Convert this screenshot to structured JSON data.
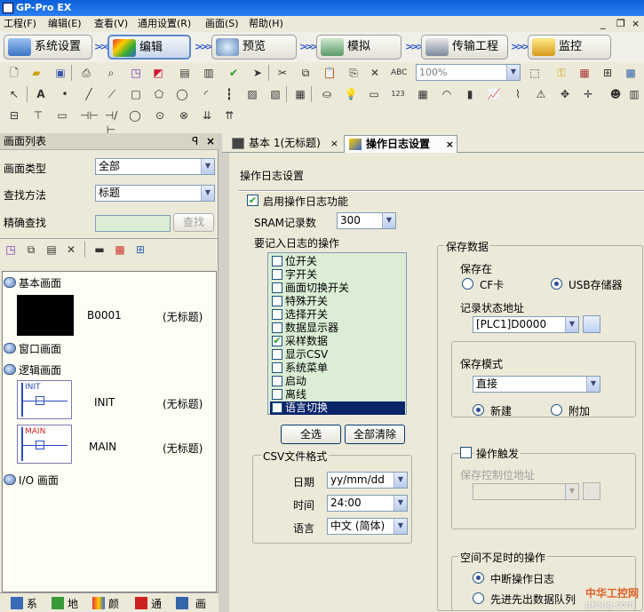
{
  "window": {
    "title": "GP-Pro EX"
  },
  "menu": [
    "工程(F)",
    "编辑(E)",
    "查看(V)",
    "通用设置(R)",
    "画面(S)",
    "帮助(H)"
  ],
  "wizard": [
    {
      "label": "系统设置",
      "icon": "system-settings-icon",
      "selected": false
    },
    {
      "label": "编辑",
      "icon": "paint-brush-icon",
      "selected": true
    },
    {
      "label": "预览",
      "icon": "preview-icon",
      "selected": false
    },
    {
      "label": "模拟",
      "icon": "simulation-icon",
      "selected": false
    },
    {
      "label": "传输工程",
      "icon": "transfer-icon",
      "selected": false
    },
    {
      "label": "监控",
      "icon": "monitor-icon",
      "selected": false
    }
  ],
  "toolbar": {
    "zoom_value": "100%"
  },
  "screen_list": {
    "title": "画面列表",
    "pin": "ꟼ",
    "close": "×",
    "type_label": "画面类型",
    "type_value": "全部",
    "method_label": "查找方法",
    "method_value": "标题",
    "search_label": "精确查找",
    "search_button": "查找",
    "tree": {
      "basic": "基本画面",
      "basic_items": [
        {
          "id": "B0001",
          "title": "(无标题)"
        }
      ],
      "window": "窗口画面",
      "logic": "逻辑画面",
      "logic_items": [
        {
          "thumb": "INIT",
          "id": "INIT",
          "title": "(无标题)"
        },
        {
          "thumb": "MAIN",
          "id": "MAIN",
          "title": "(无标题)"
        }
      ],
      "io": "I/O 画面"
    },
    "bottom_tabs": [
      "系",
      "地",
      "颜",
      "通",
      "画"
    ]
  },
  "editor_tabs": [
    {
      "label": "基本 1(无标题)",
      "active": false,
      "close": "×"
    },
    {
      "label": "操作日志设置",
      "active": true,
      "close": "×"
    }
  ],
  "oplog": {
    "section_title": "操作日志设置",
    "enable_label": "启用操作日志功能",
    "enable_checked": true,
    "sram_label": "SRAM记录数",
    "sram_value": "300",
    "ops_label": "要记入日志的操作",
    "ops": [
      {
        "label": "位开关",
        "checked": false,
        "selected": false
      },
      {
        "label": "字开关",
        "checked": false,
        "selected": false
      },
      {
        "label": "画面切换开关",
        "checked": false,
        "selected": false
      },
      {
        "label": "特殊开关",
        "checked": false,
        "selected": false
      },
      {
        "label": "选择开关",
        "checked": false,
        "selected": false
      },
      {
        "label": "数据显示器",
        "checked": false,
        "selected": false
      },
      {
        "label": "采样数据",
        "checked": true,
        "selected": false
      },
      {
        "label": "显示CSV",
        "checked": false,
        "selected": false
      },
      {
        "label": "系统菜单",
        "checked": false,
        "selected": false
      },
      {
        "label": "启动",
        "checked": false,
        "selected": false
      },
      {
        "label": "离线",
        "checked": false,
        "selected": false
      },
      {
        "label": "语言切换",
        "checked": false,
        "selected": true
      }
    ],
    "select_all": "全选",
    "clear_all": "全部清除",
    "csv": {
      "title": "CSV文件格式",
      "date_label": "日期",
      "date_value": "yy/mm/dd",
      "time_label": "时间",
      "time_value": "24:00",
      "lang_label": "语言",
      "lang_value": "中文 (简体)"
    },
    "save": {
      "title": "保存数据",
      "save_to_label": "保存在",
      "cf_label": "CF卡",
      "usb_label": "USB存储器",
      "usb_selected": true,
      "status_addr_label": "记录状态地址",
      "status_addr_value": "[PLC1]D0000",
      "mode_label": "保存模式",
      "mode_value": "直接",
      "new_label": "新建",
      "append_label": "附加",
      "new_selected": true,
      "trigger_label": "操作触发",
      "trigger_checked": false,
      "ctrl_addr_label": "保存控制位地址",
      "ctrl_addr_value": ""
    },
    "space": {
      "title": "空间不足时的操作",
      "stop_label": "中断操作日志",
      "stop_selected": true,
      "fifo_label": "先进先出数据队列",
      "fifo_selected": false
    }
  },
  "watermark": {
    "line1": "中华工控网",
    "line2": "gkong.com"
  },
  "colors": {
    "selection": "#0a246a",
    "list_bg": "#dbeed5",
    "title_bar": "#0a5fd8"
  }
}
